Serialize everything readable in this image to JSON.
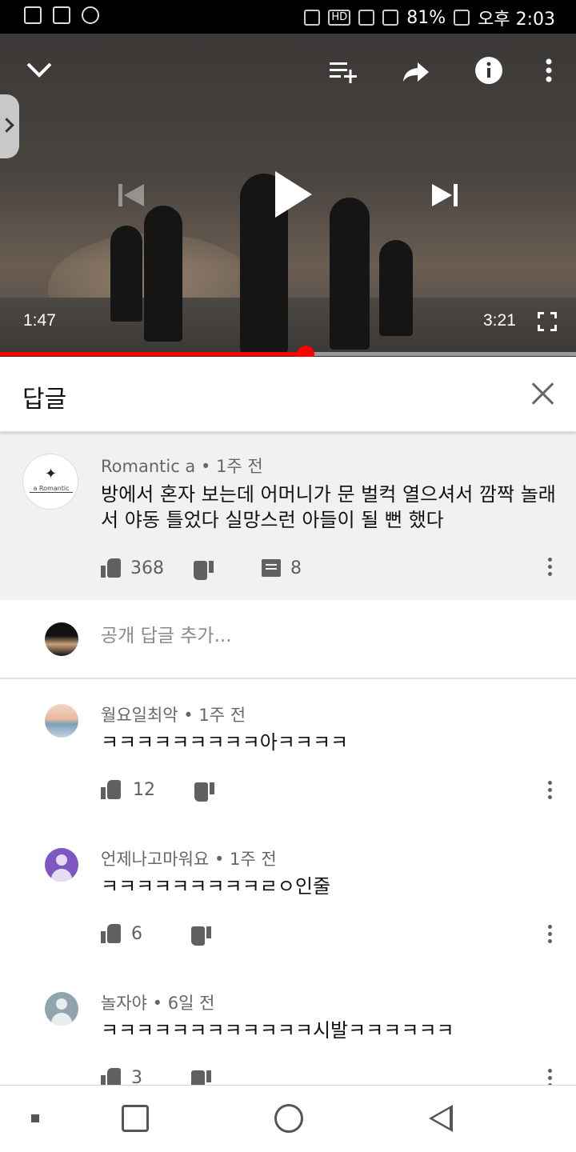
{
  "status_bar": {
    "battery": "81%",
    "time": "오후 2:03",
    "network": "HD"
  },
  "player": {
    "current_time": "1:47",
    "total_time": "3:21",
    "progress": 0.53
  },
  "replies_panel": {
    "title": "답글"
  },
  "main_comment": {
    "author": "Romantic a",
    "age": "1주 전",
    "text": "방에서 혼자 보는데 어머니가 문 벌컥 열으셔서 깜짝 놀래서 야동 틀었다 실망스런 아들이 될 뻔 했다",
    "likes": "368",
    "replies": "8",
    "avatar_label": "a Romantic"
  },
  "add_reply": {
    "placeholder": "공개 답글 추가..."
  },
  "replies": [
    {
      "author": "월요일최악",
      "age": "1주 전",
      "text": "ㅋㅋㅋㅋㅋㅋㅋㅋㅋ아ㅋㅋㅋㅋ",
      "likes": "12"
    },
    {
      "author": "언제나고마워요",
      "age": "1주 전",
      "text": "ㅋㅋㅋㅋㅋㅋㅋㅋㅋㄹㅇ인줄",
      "likes": "6"
    },
    {
      "author": "놀자야",
      "age": "6일 전",
      "text": "ㅋㅋㅋㅋㅋㅋㅋㅋㅋㅋㅋㅋ시발ㅋㅋㅋㅋㅋㅋ",
      "likes": "3"
    }
  ],
  "separator": "•",
  "colors": {
    "accent": "#ff0000",
    "panel_bg": "#f1f1f1",
    "icon": "#606060"
  }
}
